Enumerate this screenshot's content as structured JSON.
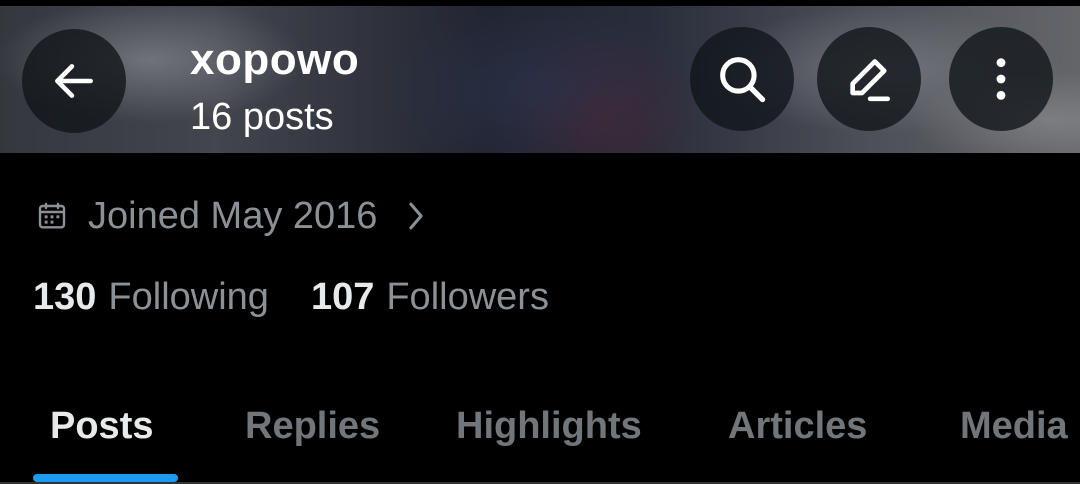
{
  "header": {
    "profile_name": "xopowo",
    "post_count": "16 posts"
  },
  "icons": {
    "back": "arrow-left-icon",
    "search": "search-icon",
    "compose": "edit-icon",
    "more": "more-vertical-icon",
    "calendar": "calendar-icon",
    "chevron": "chevron-right-icon"
  },
  "profile": {
    "joined": "Joined May 2016",
    "following_count": "130",
    "following_label": "Following",
    "followers_count": "107",
    "followers_label": "Followers"
  },
  "tabs": [
    {
      "label": "Posts",
      "active": true
    },
    {
      "label": "Replies",
      "active": false
    },
    {
      "label": "Highlights",
      "active": false
    },
    {
      "label": "Articles",
      "active": false
    },
    {
      "label": "Media",
      "active": false
    }
  ],
  "colors": {
    "accent": "#1d9bf0",
    "background": "#000000",
    "primary_text": "#e7e9ea",
    "secondary_text": "#71767b"
  }
}
